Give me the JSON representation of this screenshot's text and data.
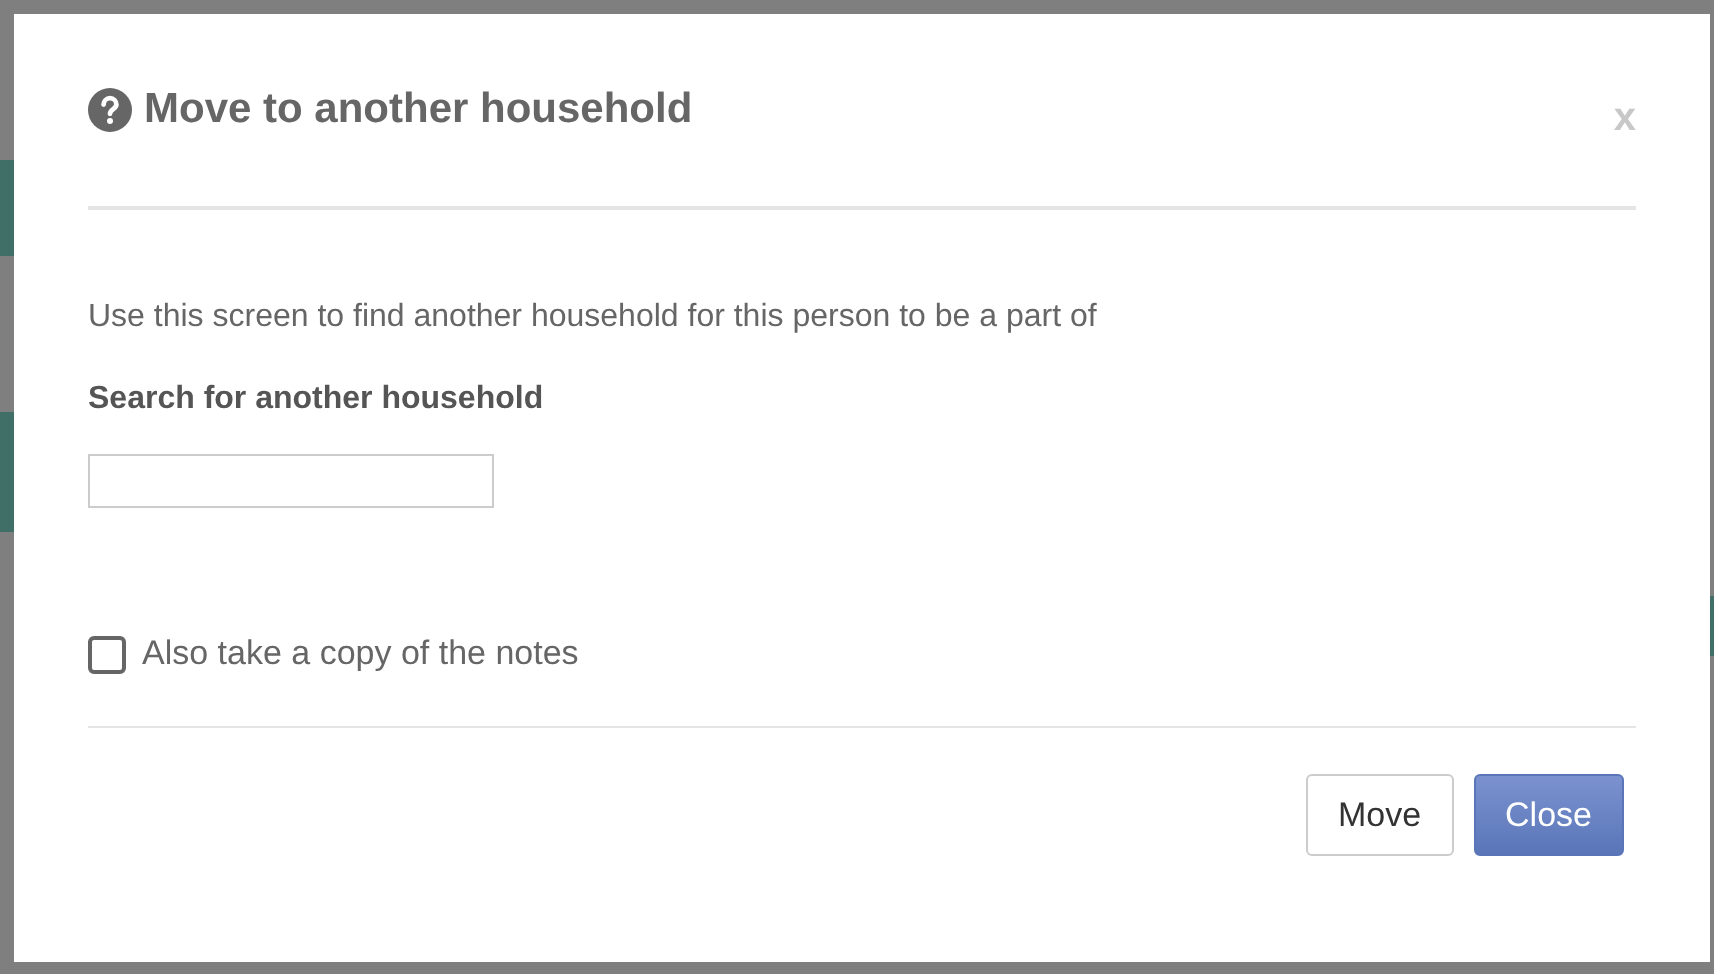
{
  "dialog": {
    "title": "Move to another household",
    "close_label": "x",
    "description": "Use this screen to find another household for this person to be a part of",
    "search_label": "Search for another household",
    "copy_notes": {
      "label": "Also take a copy of the notes",
      "checked": false
    },
    "buttons": [
      {
        "label": "Move",
        "kind": "secondary"
      },
      {
        "label": "Close",
        "kind": "primary"
      }
    ]
  }
}
